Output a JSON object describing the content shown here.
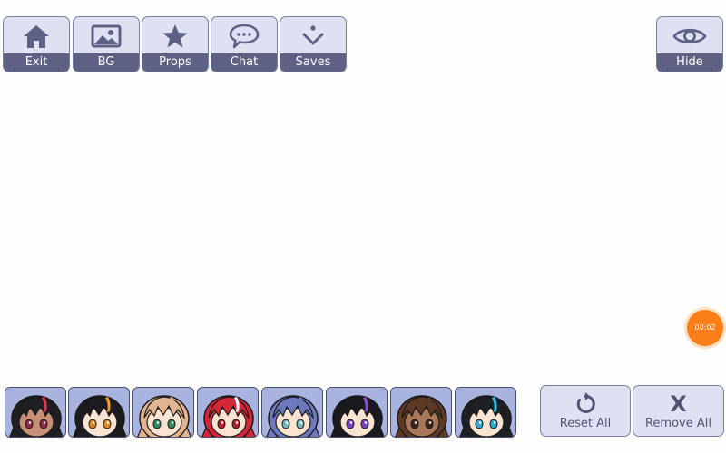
{
  "toolbar": {
    "exit": {
      "label": "Exit",
      "icon": "home-icon"
    },
    "bg": {
      "label": "BG",
      "icon": "image-icon"
    },
    "props": {
      "label": "Props",
      "icon": "star-icon"
    },
    "chat": {
      "label": "Chat",
      "icon": "chat-bubble-icon"
    },
    "saves": {
      "label": "Saves",
      "icon": "save-download-icon"
    }
  },
  "hide": {
    "label": "Hide",
    "icon": "eye-icon"
  },
  "actions": {
    "reset_all": {
      "label": "Reset All",
      "icon": "reset-icon"
    },
    "remove_all": {
      "label": "Remove All",
      "icon_text": "X"
    }
  },
  "timer": {
    "text": "00:02"
  },
  "characters": [
    {
      "hair": "#1f1f24",
      "streak": "#e0374f",
      "skin": "#c98f74",
      "eyes": "#8c2a47"
    },
    {
      "hair": "#1c1c21",
      "streak": "#f09a2c",
      "skin": "#fbe3d2",
      "eyes": "#e08a24"
    },
    {
      "hair": "#e2b48f",
      "streak": "#e2b48f",
      "skin": "#fbe3d2",
      "eyes": "#2d8c5e"
    },
    {
      "hair": "#d42638",
      "streak": "#ffffff",
      "skin": "#fbe3d2",
      "eyes": "#b61e2e"
    },
    {
      "hair": "#6d79bd",
      "streak": "#6d79bd",
      "skin": "#fbe3d2",
      "eyes": "#6fb7b0"
    },
    {
      "hair": "#1a1a21",
      "streak": "#8c4bd6",
      "skin": "#fbe3d2",
      "eyes": "#7740c2"
    },
    {
      "hair": "#5e3a26",
      "streak": "#5e3a26",
      "skin": "#a8785a",
      "eyes": "#3a2318"
    },
    {
      "hair": "#1e2125",
      "streak": "#2ec0ea",
      "skin": "#fbe3d2",
      "eyes": "#2aa8d6"
    }
  ]
}
